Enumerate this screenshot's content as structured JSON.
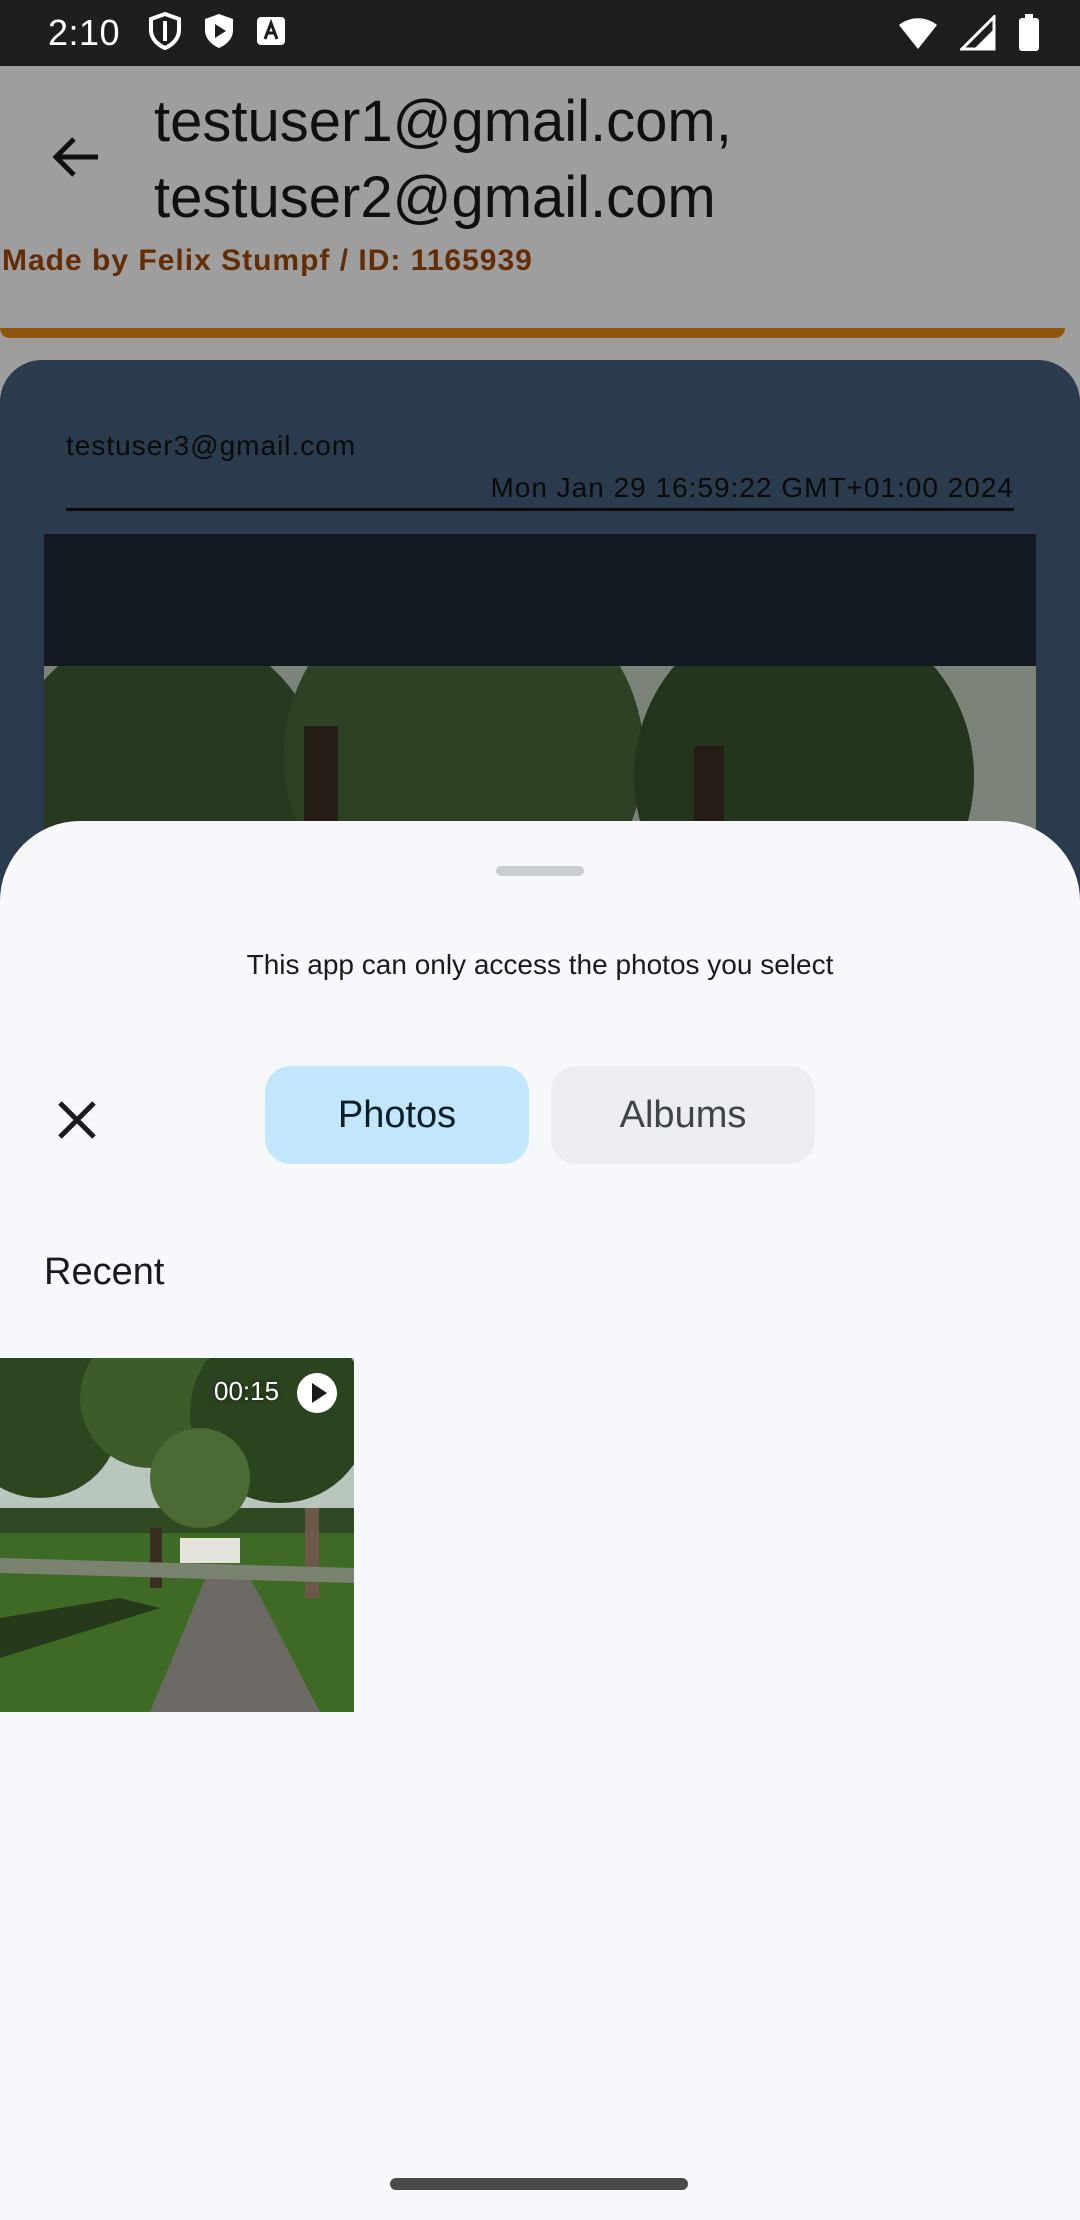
{
  "status_bar": {
    "time": "2:10",
    "left_icons": [
      "vpn-shield-icon",
      "shield-play-icon",
      "font-a-icon"
    ],
    "right_icons": [
      "wifi-icon",
      "cell-signal-icon",
      "battery-icon"
    ]
  },
  "background_screen": {
    "title": "testuser1@gmail.com, testuser2@gmail.com",
    "credit": "Made by Felix Stumpf / ID: 1165939",
    "message": {
      "sender": "testuser3@gmail.com",
      "date": "Mon Jan 29 16:59:22 GMT+01:00 2024"
    }
  },
  "picker": {
    "subtitle": "This app can only access the photos you select",
    "tabs": [
      {
        "label": "Photos",
        "selected": true
      },
      {
        "label": "Albums",
        "selected": false
      }
    ],
    "section_title": "Recent",
    "items": [
      {
        "type": "video",
        "duration": "00:15"
      }
    ]
  },
  "colors": {
    "accent_tab": "#c2e6fc",
    "sheet_bg": "#f6f8fc",
    "credit_text": "#a14a0b",
    "orange_line": "#e58b14"
  }
}
